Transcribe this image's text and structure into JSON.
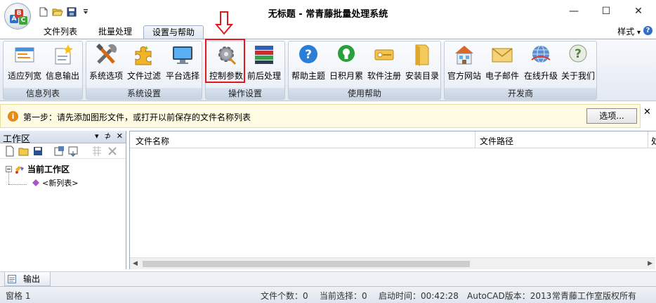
{
  "window": {
    "title": "无标题 - 常青藤批量处理系统",
    "minimize_glyph": "—",
    "maximize_glyph": "☐",
    "close_glyph": "✕"
  },
  "qat": {
    "icons": [
      "new-file-icon",
      "open-folder-icon",
      "save-icon",
      "customize-dropdown-icon"
    ]
  },
  "tabs": [
    {
      "label": "文件列表",
      "active": false
    },
    {
      "label": "批量处理",
      "active": false
    },
    {
      "label": "设置与帮助",
      "active": true
    }
  ],
  "style_menu": {
    "label": "样式",
    "arrow": "▾"
  },
  "help_glyph": "?",
  "ribbon": {
    "groups": [
      {
        "label": "信息列表",
        "buttons": [
          {
            "label": "适应列宽",
            "icon": "fit-columns-icon"
          },
          {
            "label": "信息输出",
            "icon": "info-output-icon"
          }
        ]
      },
      {
        "label": "系统设置",
        "buttons": [
          {
            "label": "系统选项",
            "icon": "tools-icon"
          },
          {
            "label": "文件过滤",
            "icon": "puzzle-icon"
          },
          {
            "label": "平台选择",
            "icon": "monitor-icon"
          }
        ]
      },
      {
        "label": "操作设置",
        "buttons": [
          {
            "label": "控制参数",
            "icon": "gear-icon"
          },
          {
            "label": "前后处理",
            "icon": "stack-icon"
          }
        ]
      },
      {
        "label": "使用帮助",
        "buttons": [
          {
            "label": "帮助主题",
            "icon": "help-icon"
          },
          {
            "label": "日积月累",
            "icon": "lightbulb-icon"
          },
          {
            "label": "软件注册",
            "icon": "key-icon"
          },
          {
            "label": "安装目录",
            "icon": "folder-icon"
          }
        ]
      },
      {
        "label": "开发商",
        "buttons": [
          {
            "label": "官方网站",
            "icon": "website-icon"
          },
          {
            "label": "电子邮件",
            "icon": "email-icon"
          },
          {
            "label": "在线升级",
            "icon": "globe-icon"
          },
          {
            "label": "关于我们",
            "icon": "about-icon"
          }
        ]
      }
    ]
  },
  "infobar": {
    "text": "第一步：请先添加图形文件，或打开以前保存的文件名称列表",
    "option_button": "选项...",
    "close_glyph": "✕",
    "icon_glyph": "i"
  },
  "workspace": {
    "title": "工作区",
    "header_buttons": [
      "▾",
      "⊅",
      "✕"
    ],
    "root": "当前工作区",
    "child": "<新列表>"
  },
  "filelist": {
    "columns": [
      "文件名称",
      "文件路径",
      "处"
    ]
  },
  "output_tab": {
    "label": "输出"
  },
  "statusbar": {
    "pane": "窗格 1",
    "file_count": "文件个数：0",
    "current_selection": "当前选择：0",
    "start_time": "启动时间：00:42:28",
    "autocad_version": "AutoCAD版本：2013",
    "copyright": "常青藤工作室版权所有"
  },
  "colors": {
    "accent": "#2f6fc7",
    "highlight_red": "#e0191f",
    "infobar_bg": "#fffbe3"
  }
}
